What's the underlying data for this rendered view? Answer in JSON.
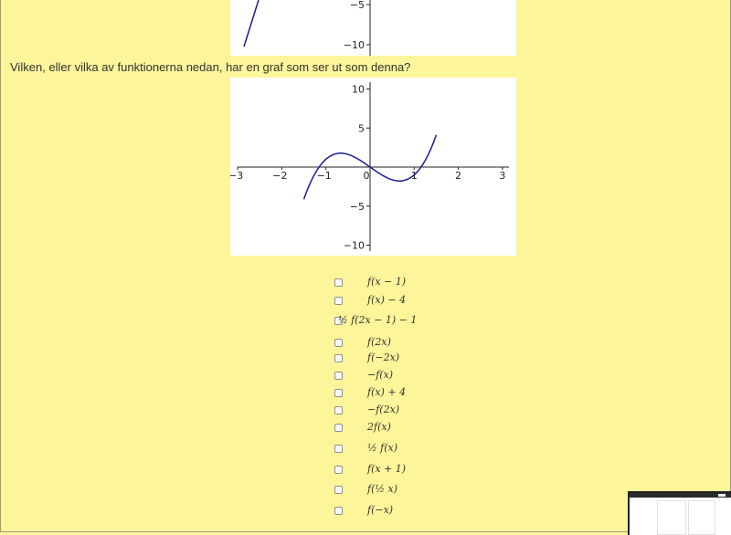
{
  "question": {
    "text": "Vilken, eller vilka av funktionerna nedan, har en graf som ser ut som denna?"
  },
  "graph_top": {
    "y_ticks": [
      {
        "value": -5,
        "label": "−5"
      },
      {
        "value": -10,
        "label": "−10"
      }
    ]
  },
  "graph_main": {
    "x_range": [
      -3,
      3
    ],
    "y_range": [
      -10,
      10
    ],
    "x_ticks": [
      {
        "value": -3,
        "label": "−3"
      },
      {
        "value": -2,
        "label": "−2"
      },
      {
        "value": -1,
        "label": "−1"
      },
      {
        "value": 0,
        "label": "0"
      },
      {
        "value": 1,
        "label": "1"
      },
      {
        "value": 2,
        "label": "2"
      },
      {
        "value": 3,
        "label": "3"
      }
    ],
    "y_ticks": [
      {
        "value": 10,
        "label": "10"
      },
      {
        "value": 5,
        "label": "5"
      },
      {
        "value": -5,
        "label": "−5"
      },
      {
        "value": -10,
        "label": "−10"
      }
    ],
    "curve_color": "#1c1c8c"
  },
  "options": [
    {
      "label": "f(x − 1)",
      "checked": false
    },
    {
      "label": "f(x) − 4",
      "checked": false
    },
    {
      "label": "½ f(2x − 1) − 1",
      "checked": false
    },
    {
      "label": "f(2x)",
      "checked": false
    },
    {
      "label": "f(−2x)",
      "checked": false
    },
    {
      "label": "−f(x)",
      "checked": false
    },
    {
      "label": "f(x) + 4",
      "checked": false
    },
    {
      "label": "−f(2x)",
      "checked": false
    },
    {
      "label": "2f(x)",
      "checked": false
    },
    {
      "label": "½ f(x)",
      "checked": false
    },
    {
      "label": "f(x + 1)",
      "checked": false
    },
    {
      "label": "f(½ x)",
      "checked": false
    },
    {
      "label": "f(−x)",
      "checked": false
    }
  ],
  "colors": {
    "page_background": "#fdf59a",
    "graph_background": "#ffffff"
  }
}
